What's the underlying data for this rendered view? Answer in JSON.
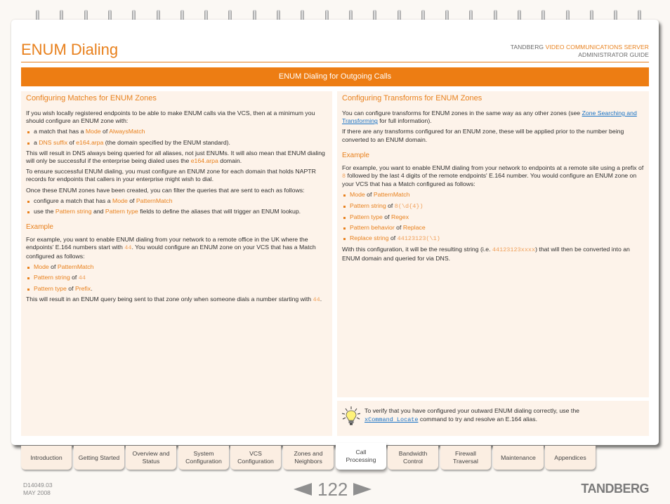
{
  "header": {
    "page_title": "ENUM Dialing",
    "brand_prefix": "TANDBERG",
    "brand_product": "VIDEO COMMUNICATIONS SERVER",
    "guide": "ADMINISTRATOR GUIDE",
    "section_bar": "ENUM Dialing for Outgoing Calls"
  },
  "left": {
    "heading": "Configuring Matches for ENUM Zones",
    "p1": "If you wish locally registered endpoints to be able to make ENUM calls via the VCS, then at a minimum you should configure an ENUM zone with:",
    "bullets1": [
      {
        "pre": "a match that has a ",
        "k1": "Mode",
        "mid": " of ",
        "k2": "AlwaysMatch",
        "post": ""
      },
      {
        "pre": "a ",
        "k1": "DNS suffix",
        "mid": " of ",
        "k2": "e164.arpa",
        "post": " (the domain specified by the ENUM standard)."
      }
    ],
    "p2_pre": "This will result in DNS always being queried for all aliases, not just ENUMs.  It will also mean that ENUM dialing will only be successful if the enterprise being dialed uses the ",
    "p2_key": "e164.arpa",
    "p2_post": " domain.",
    "p3": "To ensure successful ENUM dialing, you must configure an ENUM zone for each domain that holds NAPTR records for endpoints that callers in your enterprise might wish to dial.",
    "p4": "Once these ENUM zones have been created, you can filter the queries that are sent to each as follows:",
    "bullets2": [
      {
        "pre": "configure a match that has a ",
        "k1": "Mode",
        "mid": " of ",
        "k2": "PatternMatch",
        "post": ""
      },
      {
        "pre": "use the ",
        "k1": "Pattern string",
        "mid": " and ",
        "k2": "Pattern type",
        "post": " fields to define the aliases that will trigger an ENUM lookup."
      }
    ],
    "example_heading": "Example",
    "ex_p1_pre": "For example, you want to enable ENUM dialing from your network to a remote office in the UK where the endpoints' E.164 numbers start with ",
    "ex_p1_code": "44",
    "ex_p1_post": ".  You would configure an ENUM zone on your VCS that has a Match configured as follows:",
    "ex_bullets": [
      {
        "k1": "Mode",
        "mid": " of ",
        "v": "PatternMatch",
        "code": false,
        "post": ""
      },
      {
        "k1": "Pattern string",
        "mid": " of ",
        "v": "44",
        "code": true,
        "post": ""
      },
      {
        "k1": "Pattern type",
        "mid": " of ",
        "v": "Prefix",
        "code": false,
        "post": "."
      }
    ],
    "ex_p2_pre": "This will result in an ENUM query being sent to that zone only when someone dials a number starting with ",
    "ex_p2_code": "44",
    "ex_p2_post": "."
  },
  "right": {
    "heading": "Configuring Transforms for ENUM Zones",
    "p1_pre": "You can configure transforms for ENUM zones in the same way as any other zones (see ",
    "p1_link": "Zone Searching and Transforming",
    "p1_post": " for full information).",
    "p2": "If there are any transforms configured for an ENUM zone, these will be applied prior to the number being converted to an ENUM domain.",
    "example_heading": "Example",
    "ex_p1_pre": "For example, you want to enable ENUM dialing from your network to endpoints at a remote site using a prefix of ",
    "ex_p1_code": "8",
    "ex_p1_post": " followed by the last 4 digits of the remote endpoints' E.164 number.   You would configure an ENUM zone on your VCS that has a Match configured as follows:",
    "ex_bullets": [
      {
        "k1": "Mode",
        "v": "PatternMatch",
        "code": false
      },
      {
        "k1": "Pattern string",
        "v": "8(\\d{4})",
        "code": true
      },
      {
        "k1": "Pattern type",
        "v": "Regex",
        "code": false
      },
      {
        "k1": "Pattern behavior",
        "v": "Replace",
        "code": false
      },
      {
        "k1": "Replace string",
        "v": "44123123(\\1)",
        "code": true
      }
    ],
    "of_word": " of ",
    "ex_p2_pre": "With this configuration, it will be the resulting string (i.e. ",
    "ex_p2_code": "44123123xxxx",
    "ex_p2_post": ") that will then be converted into an ENUM domain and queried for via DNS."
  },
  "tip": {
    "icon": "lightbulb-icon",
    "line1": "To verify that you have configured your outward ENUM dialing correctly, use the",
    "command": "xCommand Locate",
    "line2_post": " command to try and resolve an E.164 alias."
  },
  "tabs": [
    {
      "label": "Introduction",
      "active": false
    },
    {
      "label": "Getting Started",
      "active": false
    },
    {
      "label": "Overview and Status",
      "active": false
    },
    {
      "label": "System Configuration",
      "active": false
    },
    {
      "label": "VCS Configuration",
      "active": false
    },
    {
      "label": "Zones and Neighbors",
      "active": false
    },
    {
      "label": "Call Processing",
      "active": true
    },
    {
      "label": "Bandwidth Control",
      "active": false
    },
    {
      "label": "Firewall Traversal",
      "active": false
    },
    {
      "label": "Maintenance",
      "active": false
    },
    {
      "label": "Appendices",
      "active": false
    }
  ],
  "footer": {
    "doc_id": "D14049.03",
    "date": "MAY 2008",
    "page_number": "122",
    "logo": "TANDBERG"
  },
  "colors": {
    "accent": "#ed7d13",
    "panel": "#fdf3ea",
    "link": "#1a73c5"
  }
}
